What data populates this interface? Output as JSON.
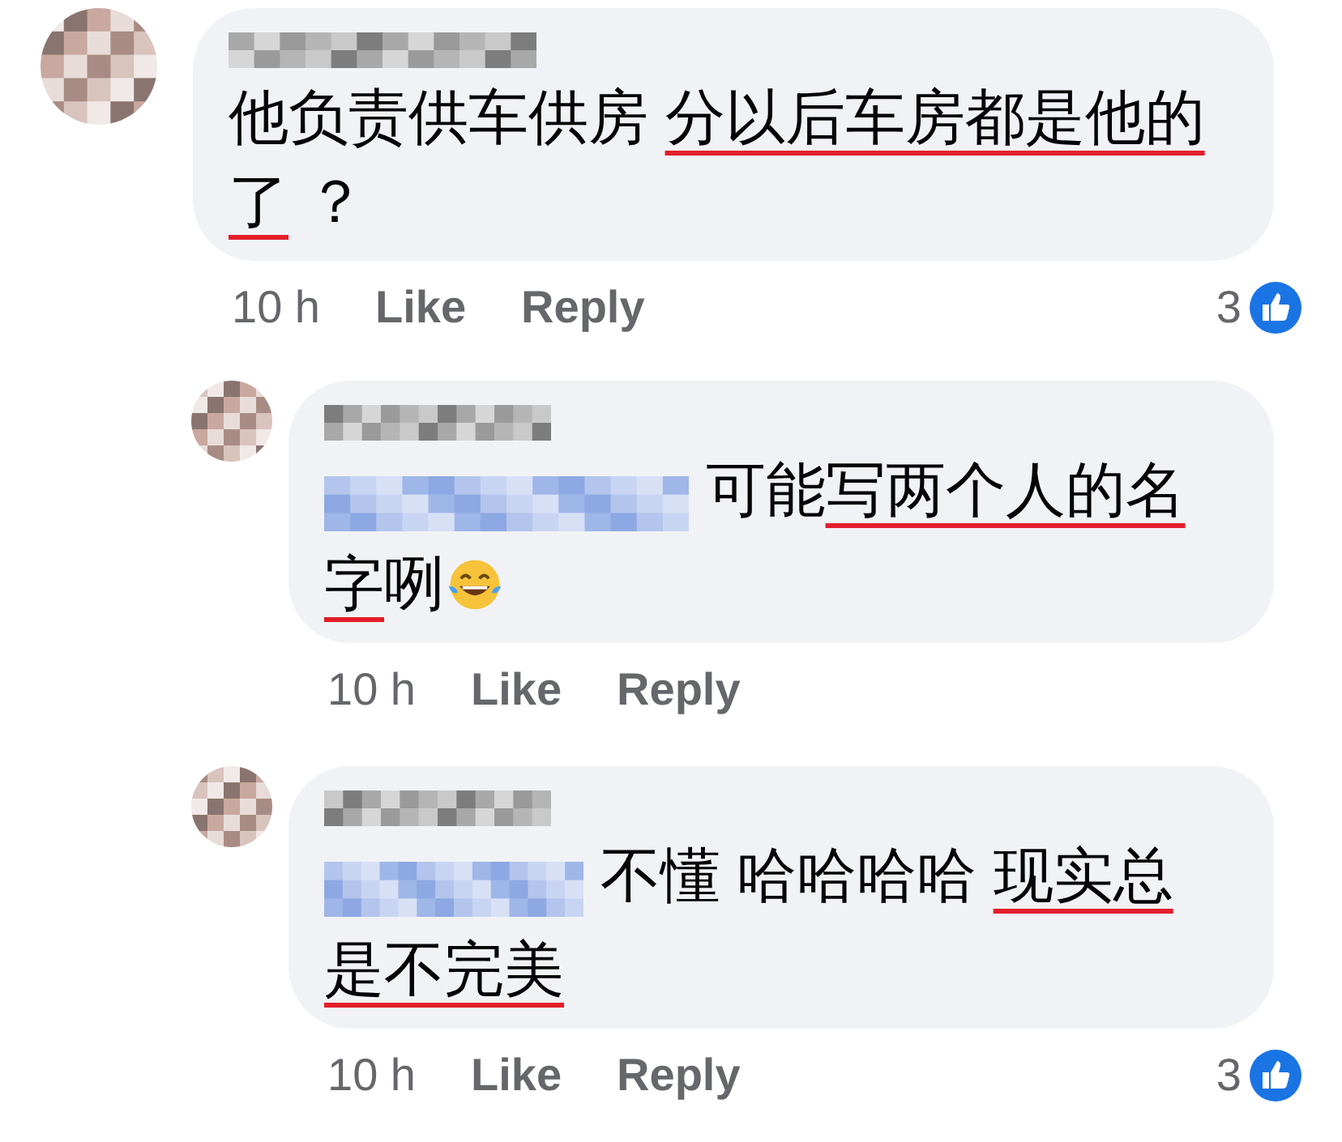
{
  "comments": [
    {
      "segments": [
        {
          "kind": "text",
          "text": "他负责供车供房 ",
          "underlined": false
        },
        {
          "kind": "text",
          "text": "分以后车房都是他的了",
          "underlined": true
        },
        {
          "kind": "text",
          "text": " ？",
          "underlined": false
        }
      ],
      "time": "10 h",
      "like": "Like",
      "reply": "Reply",
      "reactions": "3",
      "children": [
        {
          "segments": [
            {
              "kind": "mention"
            },
            {
              "kind": "text",
              "text": " 可能",
              "underlined": false
            },
            {
              "kind": "text",
              "text": "写两个人的名字",
              "underlined": true
            },
            {
              "kind": "text",
              "text": "咧",
              "underlined": false
            },
            {
              "kind": "emoji"
            }
          ],
          "time": "10 h",
          "like": "Like",
          "reply": "Reply"
        },
        {
          "segments": [
            {
              "kind": "mention"
            },
            {
              "kind": "text",
              "text": " 不懂 哈哈哈哈 ",
              "underlined": false
            },
            {
              "kind": "text",
              "text": "现实总是不完美",
              "underlined": true
            }
          ],
          "time": "10 h",
          "like": "Like",
          "reply": "Reply",
          "reactions": "3"
        }
      ]
    }
  ]
}
